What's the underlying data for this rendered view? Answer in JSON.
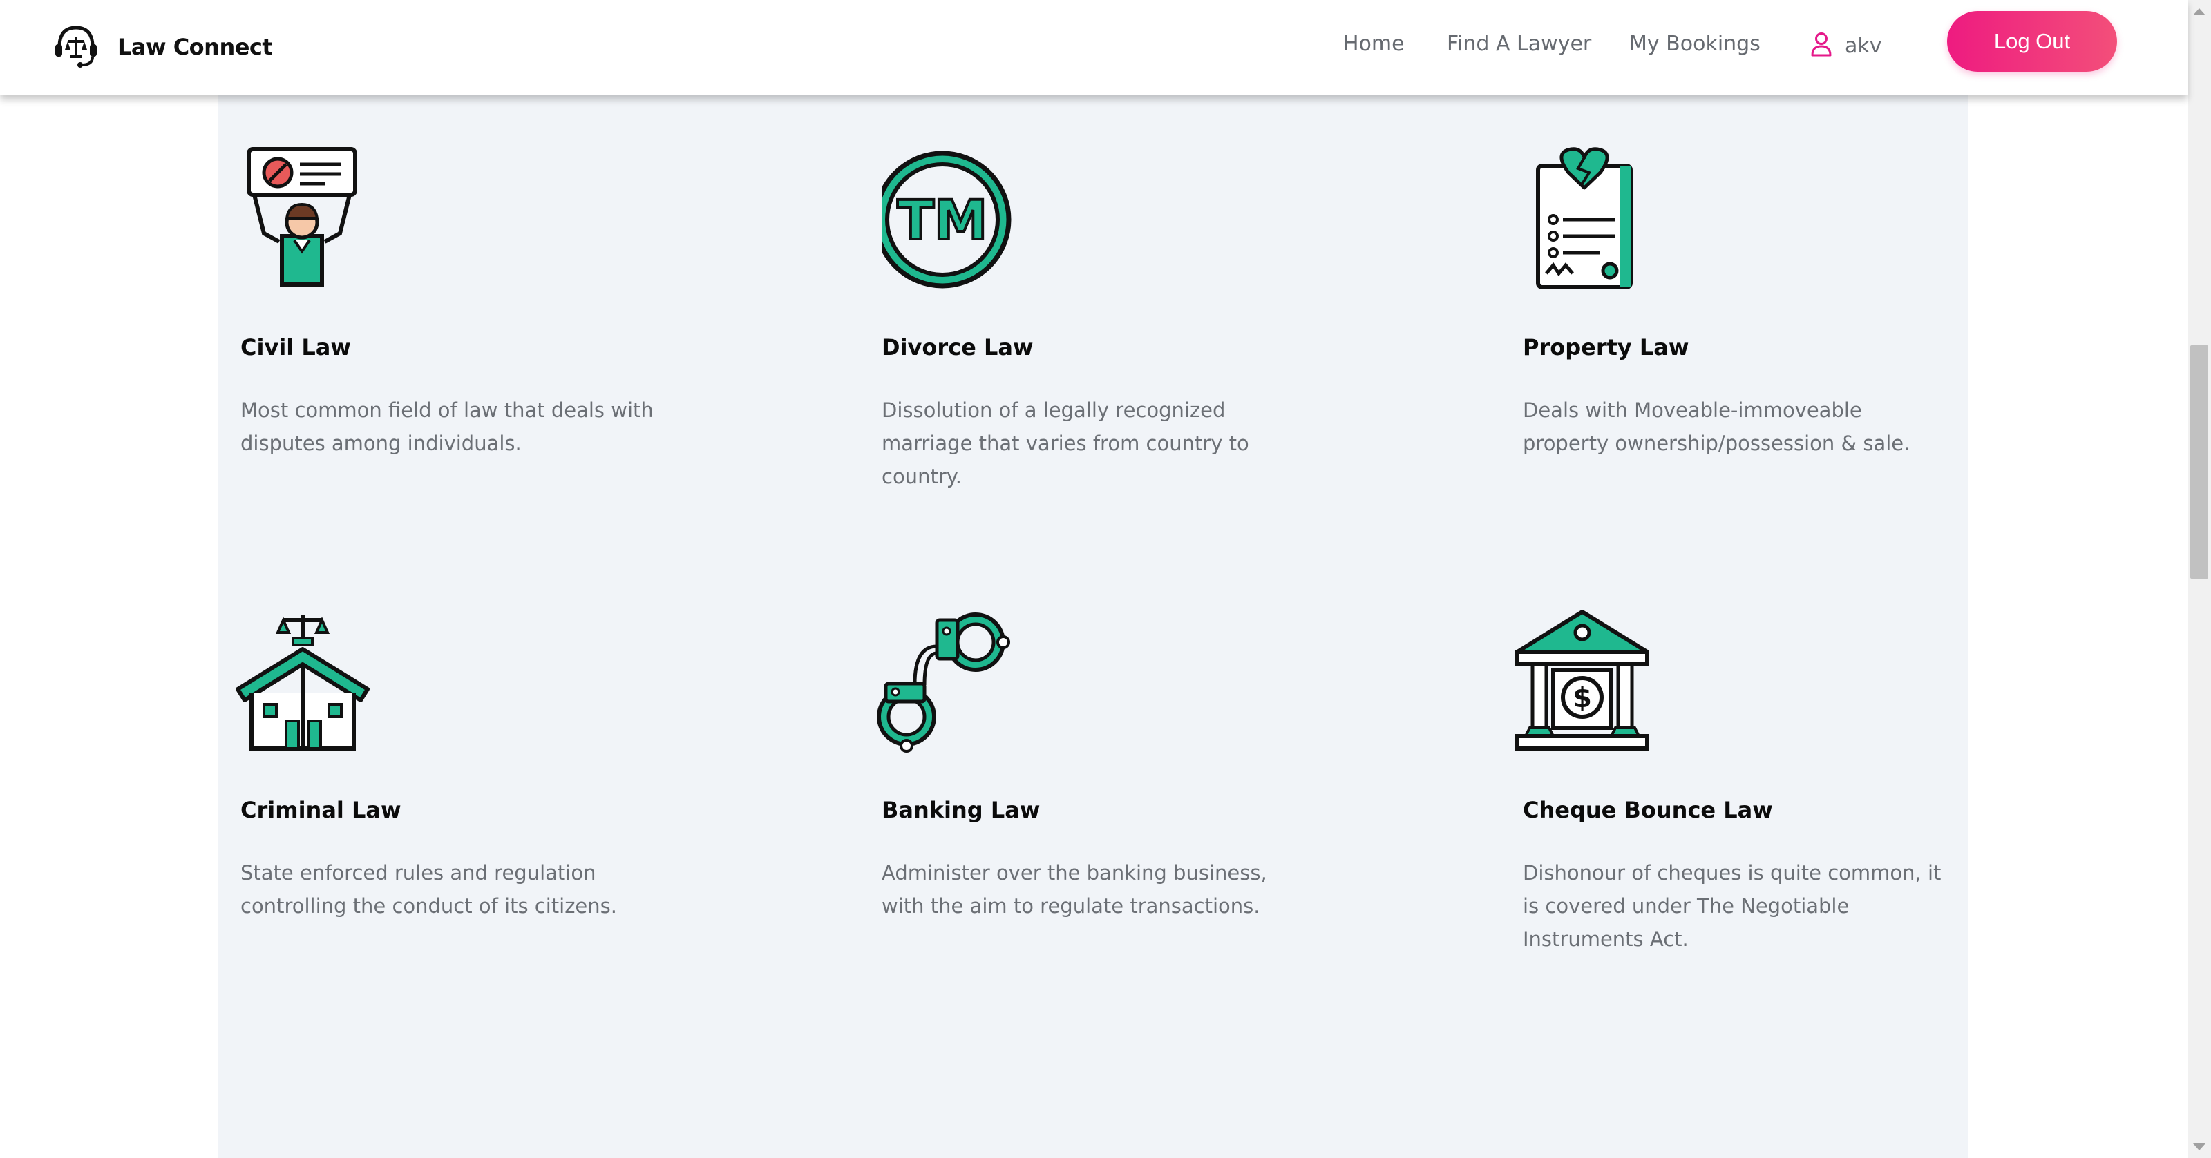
{
  "app": {
    "brand_name": "Law Connect"
  },
  "nav": {
    "home": "Home",
    "find_lawyer": "Find A Lawyer",
    "my_bookings": "My Bookings",
    "user_name": "akv",
    "logout": "Log Out"
  },
  "colors": {
    "accent": "#1fb88f",
    "brand_pink": "#ee1b80",
    "panel_bg": "#f1f4f8",
    "text_muted": "#6b6f75"
  },
  "practice_areas": [
    {
      "icon": "protester-sign-icon",
      "title": "Civil Law",
      "description": "Most common field of law that deals with disputes among individuals."
    },
    {
      "icon": "trademark-icon",
      "title": "Divorce Law",
      "description": "Dissolution of a legally recognized marriage that varies from country to country."
    },
    {
      "icon": "broken-heart-document-icon",
      "title": "Property Law",
      "description": "Deals with Moveable-immoveable property ownership/possession & sale."
    },
    {
      "icon": "courthouse-scales-icon",
      "title": "Criminal Law",
      "description": "State enforced rules and regulation controlling the conduct of its citizens."
    },
    {
      "icon": "handcuffs-icon",
      "title": "Banking Law",
      "description": "Administer over the banking business, with the aim to regulate transactions."
    },
    {
      "icon": "bank-dollar-icon",
      "title": "Cheque Bounce Law",
      "description": "Dishonour of cheques is quite common, it is covered under The Negotiable Instruments Act."
    }
  ]
}
